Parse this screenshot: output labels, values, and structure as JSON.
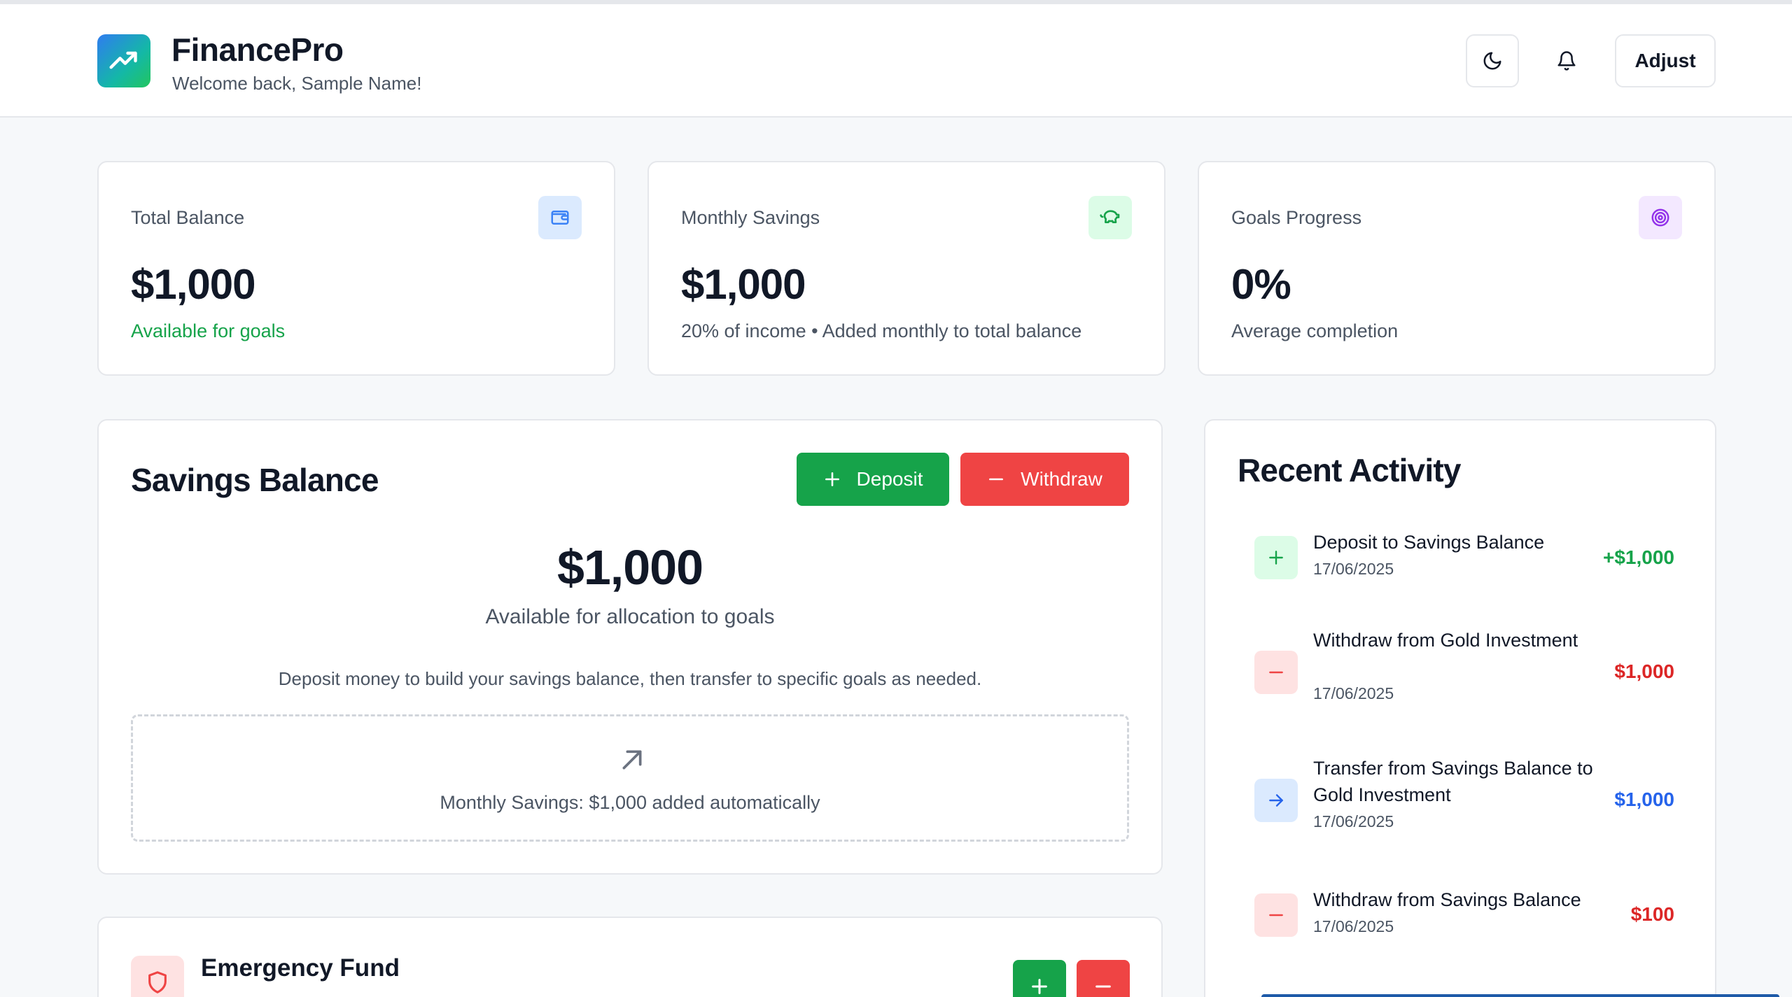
{
  "header": {
    "app_name": "FinancePro",
    "welcome": "Welcome back, Sample Name!",
    "adjust_label": "Adjust",
    "icons": [
      "trending-up-icon",
      "moon-icon",
      "bell-icon"
    ]
  },
  "stats": [
    {
      "label": "Total Balance",
      "value": "$1,000",
      "note": "Available for goals",
      "icon": "wallet-icon",
      "accent": "#3b82f6"
    },
    {
      "label": "Monthly Savings",
      "value": "$1,000",
      "note": "20% of income • Added monthly to total balance",
      "icon": "piggy-bank-icon",
      "accent": "#16a34a"
    },
    {
      "label": "Goals Progress",
      "value": "0%",
      "note": "Average completion",
      "icon": "target-icon",
      "accent": "#9333ea"
    }
  ],
  "savings": {
    "title": "Savings Balance",
    "deposit_label": "Deposit",
    "withdraw_label": "Withdraw",
    "amount": "$1,000",
    "amount_sub": "Available for allocation to goals",
    "info": "Deposit money to build your savings balance, then transfer to specific goals as needed.",
    "monthly_note": "Monthly Savings: $1,000 added automatically"
  },
  "emergency": {
    "title": "Emergency Fund"
  },
  "activity": {
    "title": "Recent Activity",
    "items": [
      {
        "title": "Deposit to Savings Balance",
        "date": "17/06/2025",
        "amount": "+$1,000",
        "kind": "deposit"
      },
      {
        "title": "Withdraw from Gold Investment",
        "date": "17/06/2025",
        "amount": "$1,000",
        "kind": "withdraw"
      },
      {
        "title": "Transfer from Savings Balance to Gold Investment",
        "date": "17/06/2025",
        "amount": "$1,000",
        "kind": "transfer"
      },
      {
        "title": "Withdraw from Savings Balance",
        "date": "17/06/2025",
        "amount": "$100",
        "kind": "withdraw"
      }
    ]
  },
  "colors": {
    "green": "#16a34a",
    "red": "#ef4444",
    "blue": "#2563eb",
    "text": "#111827",
    "muted": "#4b5563"
  }
}
